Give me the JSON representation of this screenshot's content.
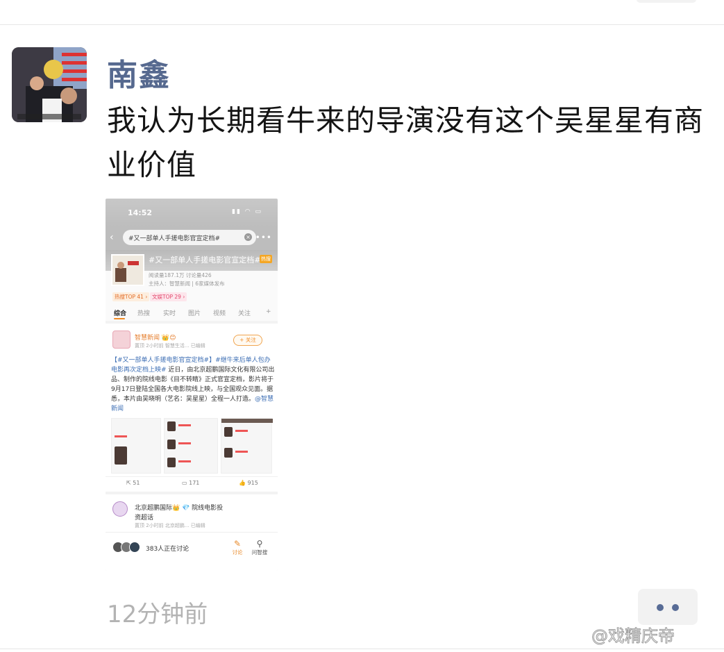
{
  "post": {
    "author": "南鑫",
    "text": "我认为长期看牛来的导演没有这个吴星星有商业价值",
    "timestamp": "12分钟前",
    "watermark": "@戏精庆帝"
  },
  "screenshot": {
    "time": "14:52",
    "search_query": "#又一部单人手搓电影官宣定档#",
    "topic": {
      "title": "#又一部单人手搓电影官宣定档#",
      "badge": "热搜",
      "stats": "阅读量187.1万  讨论量426",
      "host": "主持人：智慧新闻 | 6家媒体发布",
      "rank_hot": "热搜TOP 41 ›",
      "rank_ent": "文娱TOP 29 ›"
    },
    "tabs": [
      "综合",
      "热搜",
      "实时",
      "图片",
      "视频",
      "关注",
      "+"
    ],
    "card": {
      "name": "智慧新闻 👑😊",
      "meta": "置顶  2小时前  智慧生活...  已编辑",
      "follow": "+ 关注",
      "text_tag": "【#又一部单人手搓电影官宣定档#】#继牛来后单人包办电影再次定档上映#",
      "text_body": " 近日，由北京超鹏国际文化有限公司出品、制作的院线电影《目不转睛》正式官宣定档，影片将于9月17日登陆全国各大电影院线上映，与全国观众见面。据悉，本片由吴晓明（艺名：吴星星）全程一人打造。",
      "text_mention": "@智慧新闻",
      "reposts": "51",
      "comments": "171",
      "likes": "915"
    },
    "card2": {
      "name_line1": "北京超鹏国际👑 💎 院线电影投",
      "name_line2": "资超话",
      "meta": "置顶  2小时前  北京超鹏...  已编辑"
    },
    "bottom": {
      "discussing": "383人正在讨论",
      "discuss_btn": "讨论",
      "ask_btn": "问智搜"
    }
  }
}
